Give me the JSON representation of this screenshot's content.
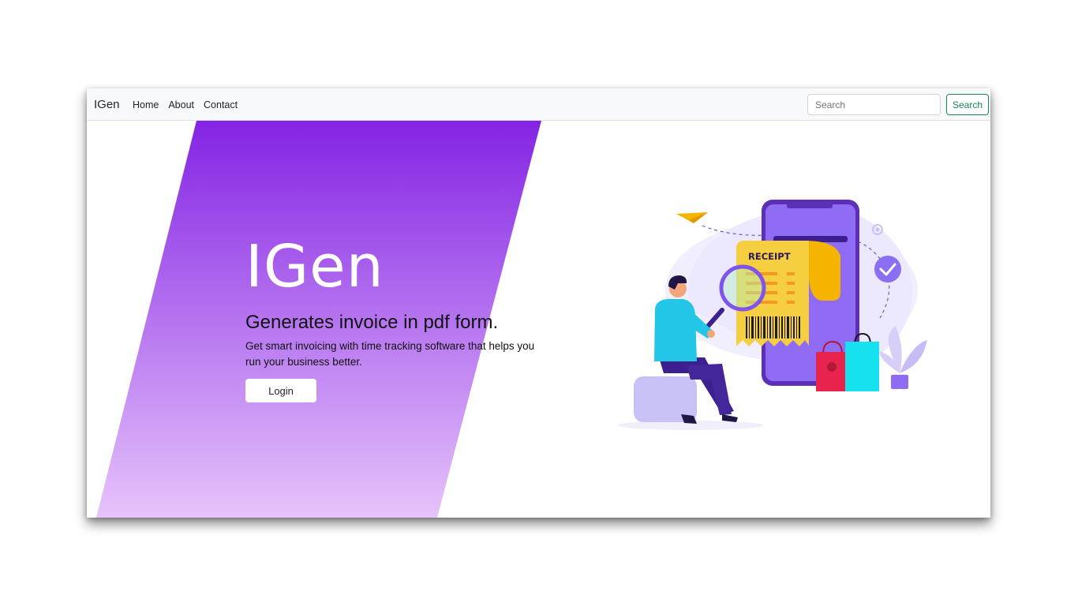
{
  "navbar": {
    "brand": "IGen",
    "links": [
      "Home",
      "About",
      "Contact"
    ],
    "search_placeholder": "Search",
    "search_button": "Search"
  },
  "hero": {
    "title": "IGen",
    "subtitle": "Generates invoice in pdf form.",
    "description": "Get smart invoicing with time tracking software that helps you run your business better.",
    "login_button": "Login"
  },
  "illustration": {
    "receipt_label": "RECEIPT"
  },
  "colors": {
    "gradient_top": "#8424e4",
    "gradient_bottom": "#e6c3fb",
    "search_accent": "#198754"
  }
}
